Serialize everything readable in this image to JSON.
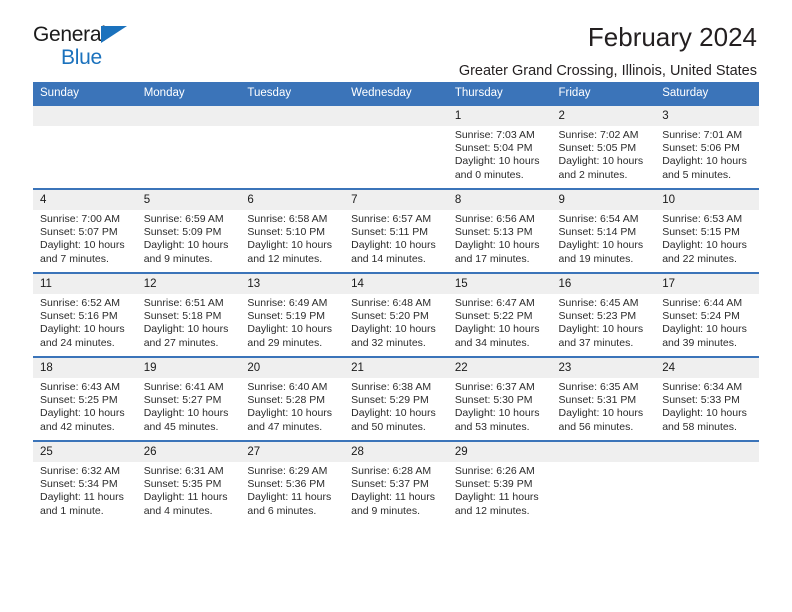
{
  "brand": {
    "line1": "General",
    "line2": "Blue",
    "triangle_color": "#1b72bd"
  },
  "header": {
    "title": "February 2024",
    "subtitle": "Greater Grand Crossing, Illinois, United States"
  },
  "theme": {
    "header_blue": "#3b74b9",
    "date_band_gray": "#efefef",
    "text": "#1a1a1a",
    "background": "#ffffff"
  },
  "weekdays": [
    "Sunday",
    "Monday",
    "Tuesday",
    "Wednesday",
    "Thursday",
    "Friday",
    "Saturday"
  ],
  "weeks": [
    [
      {
        "day": "",
        "lines": []
      },
      {
        "day": "",
        "lines": []
      },
      {
        "day": "",
        "lines": []
      },
      {
        "day": "",
        "lines": []
      },
      {
        "day": "1",
        "lines": [
          "Sunrise: 7:03 AM",
          "Sunset: 5:04 PM",
          "Daylight: 10 hours",
          "and 0 minutes."
        ]
      },
      {
        "day": "2",
        "lines": [
          "Sunrise: 7:02 AM",
          "Sunset: 5:05 PM",
          "Daylight: 10 hours",
          "and 2 minutes."
        ]
      },
      {
        "day": "3",
        "lines": [
          "Sunrise: 7:01 AM",
          "Sunset: 5:06 PM",
          "Daylight: 10 hours",
          "and 5 minutes."
        ]
      }
    ],
    [
      {
        "day": "4",
        "lines": [
          "Sunrise: 7:00 AM",
          "Sunset: 5:07 PM",
          "Daylight: 10 hours",
          "and 7 minutes."
        ]
      },
      {
        "day": "5",
        "lines": [
          "Sunrise: 6:59 AM",
          "Sunset: 5:09 PM",
          "Daylight: 10 hours",
          "and 9 minutes."
        ]
      },
      {
        "day": "6",
        "lines": [
          "Sunrise: 6:58 AM",
          "Sunset: 5:10 PM",
          "Daylight: 10 hours",
          "and 12 minutes."
        ]
      },
      {
        "day": "7",
        "lines": [
          "Sunrise: 6:57 AM",
          "Sunset: 5:11 PM",
          "Daylight: 10 hours",
          "and 14 minutes."
        ]
      },
      {
        "day": "8",
        "lines": [
          "Sunrise: 6:56 AM",
          "Sunset: 5:13 PM",
          "Daylight: 10 hours",
          "and 17 minutes."
        ]
      },
      {
        "day": "9",
        "lines": [
          "Sunrise: 6:54 AM",
          "Sunset: 5:14 PM",
          "Daylight: 10 hours",
          "and 19 minutes."
        ]
      },
      {
        "day": "10",
        "lines": [
          "Sunrise: 6:53 AM",
          "Sunset: 5:15 PM",
          "Daylight: 10 hours",
          "and 22 minutes."
        ]
      }
    ],
    [
      {
        "day": "11",
        "lines": [
          "Sunrise: 6:52 AM",
          "Sunset: 5:16 PM",
          "Daylight: 10 hours",
          "and 24 minutes."
        ]
      },
      {
        "day": "12",
        "lines": [
          "Sunrise: 6:51 AM",
          "Sunset: 5:18 PM",
          "Daylight: 10 hours",
          "and 27 minutes."
        ]
      },
      {
        "day": "13",
        "lines": [
          "Sunrise: 6:49 AM",
          "Sunset: 5:19 PM",
          "Daylight: 10 hours",
          "and 29 minutes."
        ]
      },
      {
        "day": "14",
        "lines": [
          "Sunrise: 6:48 AM",
          "Sunset: 5:20 PM",
          "Daylight: 10 hours",
          "and 32 minutes."
        ]
      },
      {
        "day": "15",
        "lines": [
          "Sunrise: 6:47 AM",
          "Sunset: 5:22 PM",
          "Daylight: 10 hours",
          "and 34 minutes."
        ]
      },
      {
        "day": "16",
        "lines": [
          "Sunrise: 6:45 AM",
          "Sunset: 5:23 PM",
          "Daylight: 10 hours",
          "and 37 minutes."
        ]
      },
      {
        "day": "17",
        "lines": [
          "Sunrise: 6:44 AM",
          "Sunset: 5:24 PM",
          "Daylight: 10 hours",
          "and 39 minutes."
        ]
      }
    ],
    [
      {
        "day": "18",
        "lines": [
          "Sunrise: 6:43 AM",
          "Sunset: 5:25 PM",
          "Daylight: 10 hours",
          "and 42 minutes."
        ]
      },
      {
        "day": "19",
        "lines": [
          "Sunrise: 6:41 AM",
          "Sunset: 5:27 PM",
          "Daylight: 10 hours",
          "and 45 minutes."
        ]
      },
      {
        "day": "20",
        "lines": [
          "Sunrise: 6:40 AM",
          "Sunset: 5:28 PM",
          "Daylight: 10 hours",
          "and 47 minutes."
        ]
      },
      {
        "day": "21",
        "lines": [
          "Sunrise: 6:38 AM",
          "Sunset: 5:29 PM",
          "Daylight: 10 hours",
          "and 50 minutes."
        ]
      },
      {
        "day": "22",
        "lines": [
          "Sunrise: 6:37 AM",
          "Sunset: 5:30 PM",
          "Daylight: 10 hours",
          "and 53 minutes."
        ]
      },
      {
        "day": "23",
        "lines": [
          "Sunrise: 6:35 AM",
          "Sunset: 5:31 PM",
          "Daylight: 10 hours",
          "and 56 minutes."
        ]
      },
      {
        "day": "24",
        "lines": [
          "Sunrise: 6:34 AM",
          "Sunset: 5:33 PM",
          "Daylight: 10 hours",
          "and 58 minutes."
        ]
      }
    ],
    [
      {
        "day": "25",
        "lines": [
          "Sunrise: 6:32 AM",
          "Sunset: 5:34 PM",
          "Daylight: 11 hours",
          "and 1 minute."
        ]
      },
      {
        "day": "26",
        "lines": [
          "Sunrise: 6:31 AM",
          "Sunset: 5:35 PM",
          "Daylight: 11 hours",
          "and 4 minutes."
        ]
      },
      {
        "day": "27",
        "lines": [
          "Sunrise: 6:29 AM",
          "Sunset: 5:36 PM",
          "Daylight: 11 hours",
          "and 6 minutes."
        ]
      },
      {
        "day": "28",
        "lines": [
          "Sunrise: 6:28 AM",
          "Sunset: 5:37 PM",
          "Daylight: 11 hours",
          "and 9 minutes."
        ]
      },
      {
        "day": "29",
        "lines": [
          "Sunrise: 6:26 AM",
          "Sunset: 5:39 PM",
          "Daylight: 11 hours",
          "and 12 minutes."
        ]
      },
      {
        "day": "",
        "lines": []
      },
      {
        "day": "",
        "lines": []
      }
    ]
  ]
}
